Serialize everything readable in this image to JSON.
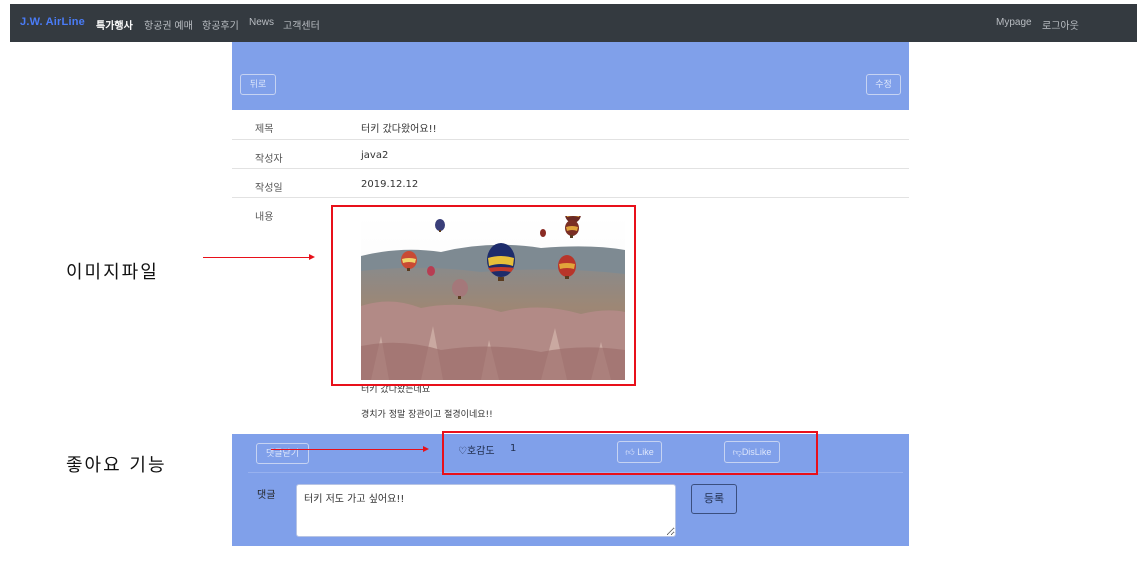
{
  "navbar": {
    "brand": "J.W. AirLine",
    "links": [
      "특가행사",
      "항공권 예매",
      "항공후기",
      "News",
      "고객센터"
    ],
    "right_links": [
      "Mypage",
      "로그아웃"
    ]
  },
  "post": {
    "back_label": "뒤로",
    "edit_label": "수정",
    "fields": [
      {
        "label": "제목",
        "value": "터키 갔다왔어요!!"
      },
      {
        "label": "작성자",
        "value": "java2"
      },
      {
        "label": "작성일",
        "value": "2019.12.12"
      }
    ],
    "content_label": "내용",
    "content_lines": [
      "터키 갔다왔는데요",
      "경치가 정말 장관이고 절경이네요!!"
    ],
    "image_alt": "hot air balloons over cappadocia"
  },
  "reactions": {
    "reply_close_label": "댓글닫기",
    "favor_label": "호감도",
    "favor_count": "1",
    "like_label": "Like",
    "dislike_label": "DisLike"
  },
  "comment": {
    "label": "댓글",
    "value": "터키 저도 가고 싶어요!!",
    "submit_label": "등록"
  },
  "annotations": {
    "image_file": "이미지파일",
    "like_feature": "좋아요 기능"
  },
  "colors": {
    "navbar_bg": "#343a40",
    "brand": "#4a7cf7",
    "band": "#80a0ea",
    "annotation_red": "#e8101a"
  }
}
